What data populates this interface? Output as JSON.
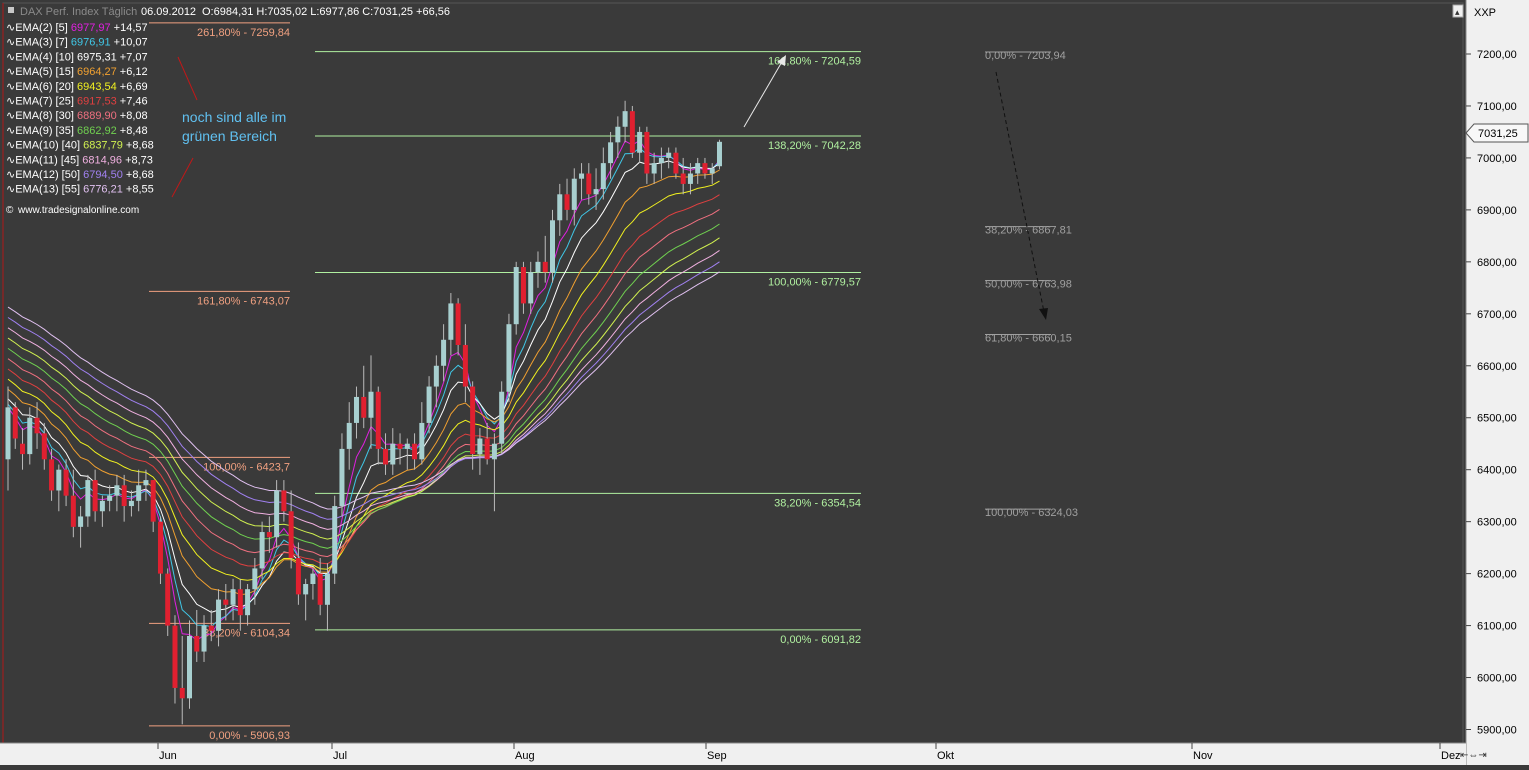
{
  "header": {
    "instrument": "DAX Perf. Index Täglich",
    "date": "06.09.2012",
    "ohlc": "O:6984,31 H:7035,02 L:6977,86 C:7031,25 +66,56"
  },
  "price_axis": {
    "label": "XXP",
    "last_price": "7031,25",
    "ticks": [
      "7200,00",
      "7100,00",
      "7000,00",
      "6900,00",
      "6800,00",
      "6700,00",
      "6600,00",
      "6500,00",
      "6400,00",
      "6300,00",
      "6200,00",
      "6100,00",
      "6000,00",
      "5900,00"
    ]
  },
  "time_axis": {
    "labels": [
      "Jun",
      "Jul",
      "Aug",
      "Sep",
      "Okt",
      "Nov",
      "Dez"
    ]
  },
  "ema_legend": [
    {
      "name": "EMA(2) [5]",
      "value": "6977,97",
      "change": "+14,57",
      "color": "#e020e0"
    },
    {
      "name": "EMA(3) [7]",
      "value": "6976,91",
      "change": "+10,07",
      "color": "#40c8e8"
    },
    {
      "name": "EMA(4) [10]",
      "value": "6975,31",
      "change": "+7,07",
      "color": "#ffffff"
    },
    {
      "name": "EMA(5) [15]",
      "value": "6964,27",
      "change": "+6,12",
      "color": "#f0a030"
    },
    {
      "name": "EMA(6) [20]",
      "value": "6943,54",
      "change": "+6,69",
      "color": "#f0f020"
    },
    {
      "name": "EMA(7) [25]",
      "value": "6917,53",
      "change": "+7,46",
      "color": "#e04040"
    },
    {
      "name": "EMA(8) [30]",
      "value": "6889,90",
      "change": "+8,08",
      "color": "#f07080"
    },
    {
      "name": "EMA(9) [35]",
      "value": "6862,92",
      "change": "+8,48",
      "color": "#70d050"
    },
    {
      "name": "EMA(10) [40]",
      "value": "6837,79",
      "change": "+8,68",
      "color": "#d0f050"
    },
    {
      "name": "EMA(11) [45]",
      "value": "6814,96",
      "change": "+8,73",
      "color": "#f0b0e0"
    },
    {
      "name": "EMA(12) [50]",
      "value": "6794,50",
      "change": "+8,68",
      "color": "#a080f0"
    },
    {
      "name": "EMA(13) [55]",
      "value": "6776,21",
      "change": "+8,55",
      "color": "#e0c0f0"
    }
  ],
  "copyright": "www.tradesignalonline.com",
  "annotation": "noch sind alle im grünen Bereich",
  "annotation_lines": [
    "noch sind alle im",
    "grünen Bereich"
  ],
  "fib_left": [
    {
      "label": "261,80% - 7259,84",
      "value": 7259.84
    },
    {
      "label": "161,80% - 6743,07",
      "value": 6743.07
    },
    {
      "label": "100,00% - 6423,7",
      "value": 6423.7
    },
    {
      "label": "38,20% - 6104,34",
      "value": 6104.34
    },
    {
      "label": "0,00% - 5906,93",
      "value": 5906.93
    }
  ],
  "fib_mid": [
    {
      "label": "161,80% - 7204,59",
      "value": 7204.59
    },
    {
      "label": "138,20% - 7042,28",
      "value": 7042.28
    },
    {
      "label": "100,00% - 6779,57",
      "value": 6779.57
    },
    {
      "label": "38,20% - 6354,54",
      "value": 6354.54
    },
    {
      "label": "0,00% - 6091,82",
      "value": 6091.82
    }
  ],
  "fib_right": [
    {
      "label": "0,00% - 7203,94",
      "value": 7203.94
    },
    {
      "label": "38,20% - 6867,81",
      "value": 6867.81
    },
    {
      "label": "50,00% - 6763,98",
      "value": 6763.98
    },
    {
      "label": "61,80% - 6660,15",
      "value": 6660.15
    },
    {
      "label": "100,00% - 6324,03",
      "value": 6324.03
    }
  ],
  "colors": {
    "background": "#3a3a3a",
    "up_candle": "#a8d0d0",
    "down_candle": "#e02030",
    "fib_left": "#f0a080",
    "fib_mid": "#b0f0a0",
    "fib_right": "#a0a0a0"
  },
  "chart_data": {
    "type": "candlestick",
    "ylim": [
      5880,
      7250
    ],
    "candles": [
      [
        6420,
        6560,
        6360,
        6520
      ],
      [
        6520,
        6530,
        6440,
        6460
      ],
      [
        6450,
        6480,
        6400,
        6430
      ],
      [
        6430,
        6520,
        6410,
        6500
      ],
      [
        6500,
        6530,
        6440,
        6470
      ],
      [
        6470,
        6490,
        6400,
        6420
      ],
      [
        6420,
        6440,
        6340,
        6360
      ],
      [
        6360,
        6410,
        6320,
        6400
      ],
      [
        6400,
        6420,
        6330,
        6350
      ],
      [
        6350,
        6400,
        6270,
        6290
      ],
      [
        6290,
        6330,
        6250,
        6310
      ],
      [
        6310,
        6390,
        6290,
        6380
      ],
      [
        6380,
        6400,
        6300,
        6320
      ],
      [
        6320,
        6350,
        6290,
        6340
      ],
      [
        6340,
        6370,
        6320,
        6350
      ],
      [
        6350,
        6390,
        6320,
        6370
      ],
      [
        6370,
        6390,
        6300,
        6330
      ],
      [
        6330,
        6360,
        6310,
        6340
      ],
      [
        6340,
        6400,
        6320,
        6370
      ],
      [
        6370,
        6400,
        6340,
        6380
      ],
      [
        6380,
        6380,
        6280,
        6300
      ],
      [
        6300,
        6310,
        6180,
        6200
      ],
      [
        6200,
        6210,
        6080,
        6100
      ],
      [
        6100,
        6120,
        5950,
        5980
      ],
      [
        5980,
        6080,
        5910,
        5960
      ],
      [
        5960,
        6110,
        5940,
        6080
      ],
      [
        6080,
        6130,
        6030,
        6050
      ],
      [
        6050,
        6120,
        6030,
        6100
      ],
      [
        6100,
        6130,
        6070,
        6090
      ],
      [
        6090,
        6170,
        6060,
        6150
      ],
      [
        6150,
        6180,
        6110,
        6140
      ],
      [
        6140,
        6190,
        6110,
        6170
      ],
      [
        6170,
        6190,
        6090,
        6120
      ],
      [
        6120,
        6180,
        6100,
        6170
      ],
      [
        6170,
        6230,
        6140,
        6210
      ],
      [
        6210,
        6300,
        6190,
        6280
      ],
      [
        6280,
        6310,
        6240,
        6270
      ],
      [
        6270,
        6380,
        6250,
        6360
      ],
      [
        6360,
        6380,
        6300,
        6320
      ],
      [
        6320,
        6360,
        6210,
        6230
      ],
      [
        6230,
        6260,
        6140,
        6160
      ],
      [
        6160,
        6190,
        6110,
        6180
      ],
      [
        6180,
        6210,
        6150,
        6200
      ],
      [
        6200,
        6230,
        6120,
        6140
      ],
      [
        6140,
        6220,
        6090,
        6200
      ],
      [
        6200,
        6350,
        6180,
        6330
      ],
      [
        6330,
        6470,
        6310,
        6440
      ],
      [
        6440,
        6530,
        6400,
        6490
      ],
      [
        6490,
        6560,
        6460,
        6540
      ],
      [
        6540,
        6600,
        6480,
        6500
      ],
      [
        6500,
        6620,
        6440,
        6550
      ],
      [
        6550,
        6560,
        6410,
        6440
      ],
      [
        6440,
        6470,
        6390,
        6410
      ],
      [
        6410,
        6480,
        6390,
        6450
      ],
      [
        6450,
        6470,
        6410,
        6440
      ],
      [
        6440,
        6460,
        6400,
        6450
      ],
      [
        6450,
        6470,
        6400,
        6420
      ],
      [
        6420,
        6530,
        6410,
        6490
      ],
      [
        6490,
        6580,
        6470,
        6560
      ],
      [
        6560,
        6620,
        6520,
        6600
      ],
      [
        6600,
        6680,
        6570,
        6650
      ],
      [
        6650,
        6740,
        6620,
        6720
      ],
      [
        6720,
        6730,
        6620,
        6640
      ],
      [
        6640,
        6680,
        6530,
        6560
      ],
      [
        6560,
        6570,
        6400,
        6430
      ],
      [
        6430,
        6480,
        6390,
        6460
      ],
      [
        6460,
        6490,
        6410,
        6420
      ],
      [
        6420,
        6470,
        6320,
        6450
      ],
      [
        6450,
        6570,
        6430,
        6550
      ],
      [
        6550,
        6700,
        6530,
        6680
      ],
      [
        6680,
        6800,
        6660,
        6790
      ],
      [
        6790,
        6800,
        6700,
        6720
      ],
      [
        6720,
        6800,
        6700,
        6780
      ],
      [
        6780,
        6820,
        6750,
        6800
      ],
      [
        6800,
        6850,
        6760,
        6780
      ],
      [
        6780,
        6900,
        6760,
        6880
      ],
      [
        6880,
        6950,
        6850,
        6930
      ],
      [
        6930,
        6960,
        6880,
        6900
      ],
      [
        6900,
        6980,
        6870,
        6960
      ],
      [
        6960,
        6990,
        6920,
        6970
      ],
      [
        6970,
        6990,
        6910,
        6930
      ],
      [
        6930,
        6980,
        6900,
        6940
      ],
      [
        6940,
        7020,
        6920,
        6990
      ],
      [
        6990,
        7050,
        6960,
        7030
      ],
      [
        7030,
        7080,
        7000,
        7060
      ],
      [
        7060,
        7110,
        7030,
        7090
      ],
      [
        7090,
        7100,
        7000,
        7010
      ],
      [
        7010,
        7060,
        6990,
        7050
      ],
      [
        7050,
        7060,
        6950,
        6970
      ],
      [
        6970,
        7010,
        6950,
        6990
      ],
      [
        6990,
        7020,
        6960,
        7000
      ],
      [
        7000,
        7020,
        6980,
        7010
      ],
      [
        7010,
        7020,
        6960,
        6970
      ],
      [
        6970,
        7000,
        6930,
        6950
      ],
      [
        6950,
        6990,
        6930,
        6970
      ],
      [
        6970,
        7000,
        6950,
        6990
      ],
      [
        6990,
        7000,
        6960,
        6970
      ],
      [
        6970,
        6990,
        6950,
        6980
      ],
      [
        6984,
        7035,
        6978,
        7031
      ]
    ],
    "ema_periods": [
      5,
      7,
      10,
      15,
      20,
      25,
      30,
      35,
      40,
      45,
      50,
      55
    ]
  }
}
